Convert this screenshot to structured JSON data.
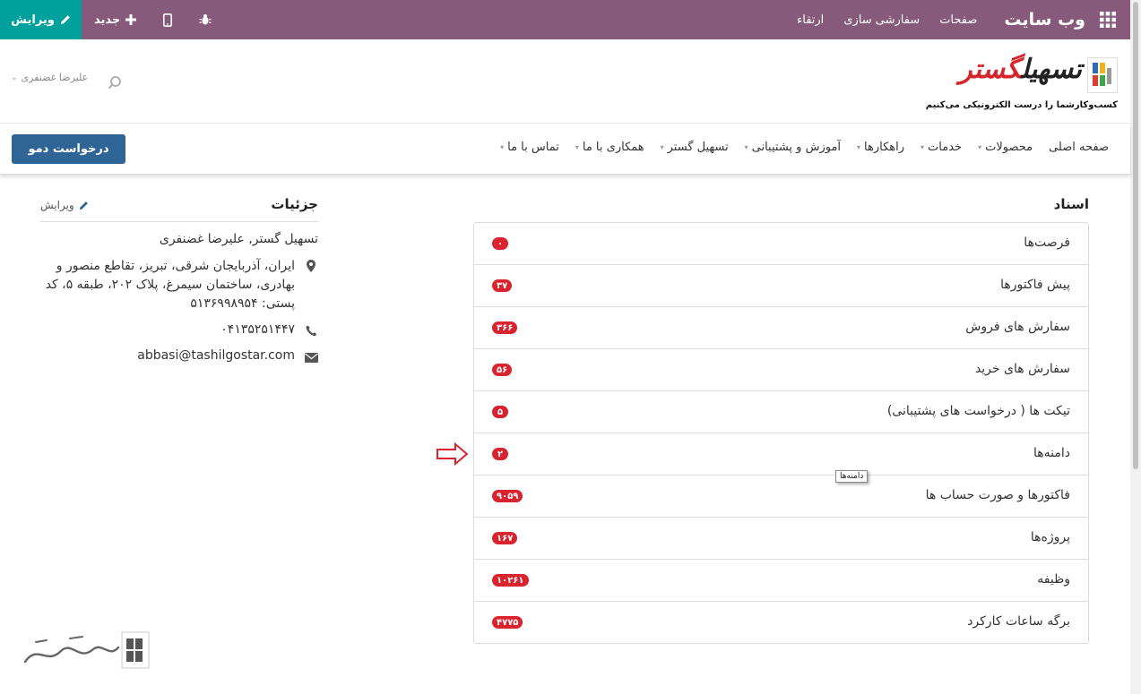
{
  "topbar": {
    "brand": "وب سایت",
    "menu": [
      "صفحات",
      "سفارشی سازی",
      "ارتقاء"
    ],
    "new_label": "جدید",
    "edit_label": "ویرایش",
    "apps_icon": "apps-grid-icon",
    "mobile_icon": "mobile-icon",
    "debug_icon": "bug-icon",
    "bg_color": "#875a7b",
    "edit_color": "#00a09d"
  },
  "header": {
    "logo_text_dark": "تسهیل",
    "logo_text_red": "گستر",
    "tagline": "کسب‌وکارشما را درست الکترونیکی می‌کنیم",
    "user_name": "علیرضا غضنفری"
  },
  "nav": {
    "items": [
      {
        "label": "صفحه اصلی",
        "dropdown": false
      },
      {
        "label": "محصولات",
        "dropdown": true
      },
      {
        "label": "خدمات",
        "dropdown": true
      },
      {
        "label": "راهکارها",
        "dropdown": true
      },
      {
        "label": "آموزش و پشتیبانی",
        "dropdown": true
      },
      {
        "label": "تسهیل گستر",
        "dropdown": true
      },
      {
        "label": "همکاری با ما",
        "dropdown": true
      },
      {
        "label": "تماس با ما",
        "dropdown": true
      }
    ],
    "demo_button": "درخواست دمو"
  },
  "documents": {
    "title": "اسناد",
    "rows": [
      {
        "label": "فرصت‌ها",
        "count": "۰"
      },
      {
        "label": "پیش فاکتورها",
        "count": "۳۷"
      },
      {
        "label": "سفارش های فروش",
        "count": "۳۶۶"
      },
      {
        "label": "سفارش های خرید",
        "count": "۵۶"
      },
      {
        "label": "تیکت ها ( درخواست های پشتیبانی)",
        "count": "۵"
      },
      {
        "label": "دامنه‌ها",
        "count": "۲"
      },
      {
        "label": "فاکتورها و صورت حساب ها",
        "count": "۹۰۵۹"
      },
      {
        "label": "پروژه‌ها",
        "count": "۱۶۷"
      },
      {
        "label": "وظیفه",
        "count": "۱۰۲۶۱"
      },
      {
        "label": "برگه ساعات کارکرد",
        "count": "۴۷۷۵"
      }
    ],
    "tooltip": "دامنه‌ها",
    "badge_color": "#d9232e"
  },
  "details": {
    "title": "جزئیات",
    "edit_label": "ویرایش",
    "name": "تسهیل گستر, علیرضا غضنفری",
    "address": "ایران، آذربایجان شرقی، تبریز، تقاطع منصور و بهادری، ساختمان سیمرغ، پلاک ۲۰۲، طبقه ۵، کد پستی: ۵۱۳۶۹۹۸۹۵۴",
    "phone": "۰۴۱۳۵۲۵۱۴۴۷",
    "email": "abbasi@tashilgostar.com"
  }
}
